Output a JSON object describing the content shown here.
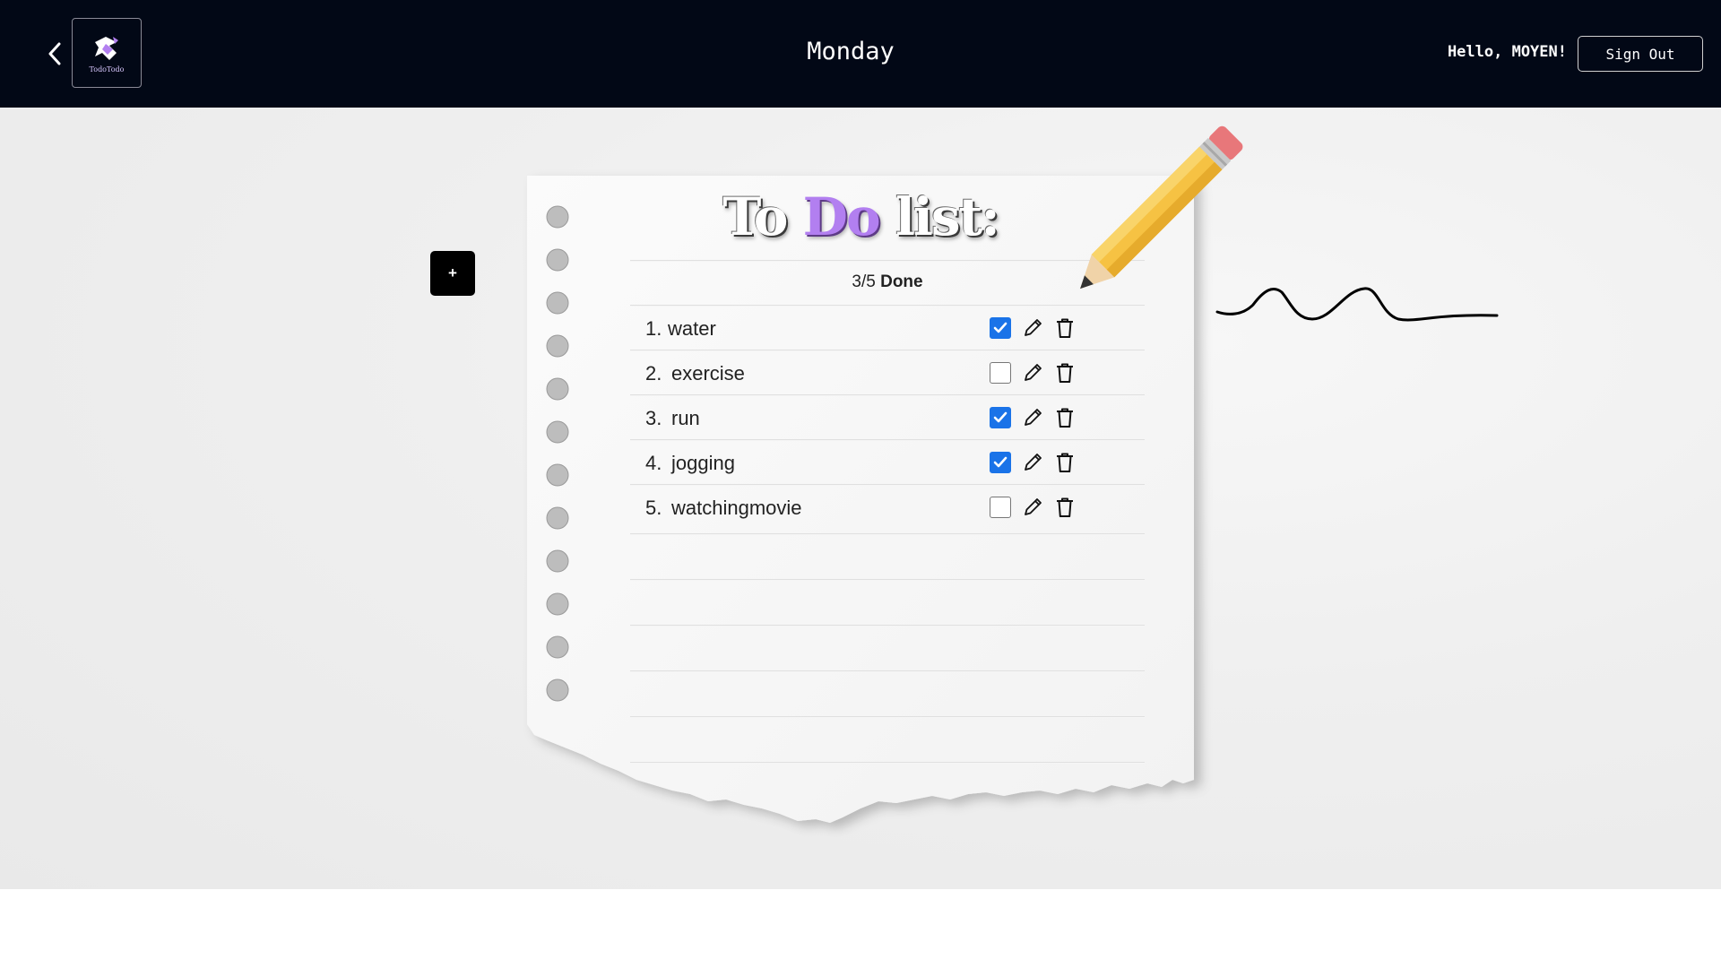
{
  "header": {
    "logo_text": "TodoTodo",
    "title": "Monday",
    "greeting": "Hello, MOYEN!",
    "signout_label": "Sign Out"
  },
  "toolbar": {
    "add_label": "+"
  },
  "list": {
    "title_part1": "To ",
    "title_accent": "Do",
    "title_part2": " list:",
    "done_count": "3/5",
    "done_word": "Done",
    "accent_color": "#b27ff0",
    "tasks": [
      {
        "num": "1.",
        "label": "water",
        "done": true
      },
      {
        "num": "2.",
        "label": "exercise",
        "done": false
      },
      {
        "num": "3.",
        "label": "run",
        "done": true
      },
      {
        "num": "4.",
        "label": "jogging",
        "done": true
      },
      {
        "num": "5.",
        "label": "watchingmovie",
        "done": false
      }
    ]
  },
  "icons": {
    "back": "chevron-left-icon",
    "edit": "pencil-icon",
    "delete": "trash-icon",
    "check": "checkmark-icon"
  }
}
